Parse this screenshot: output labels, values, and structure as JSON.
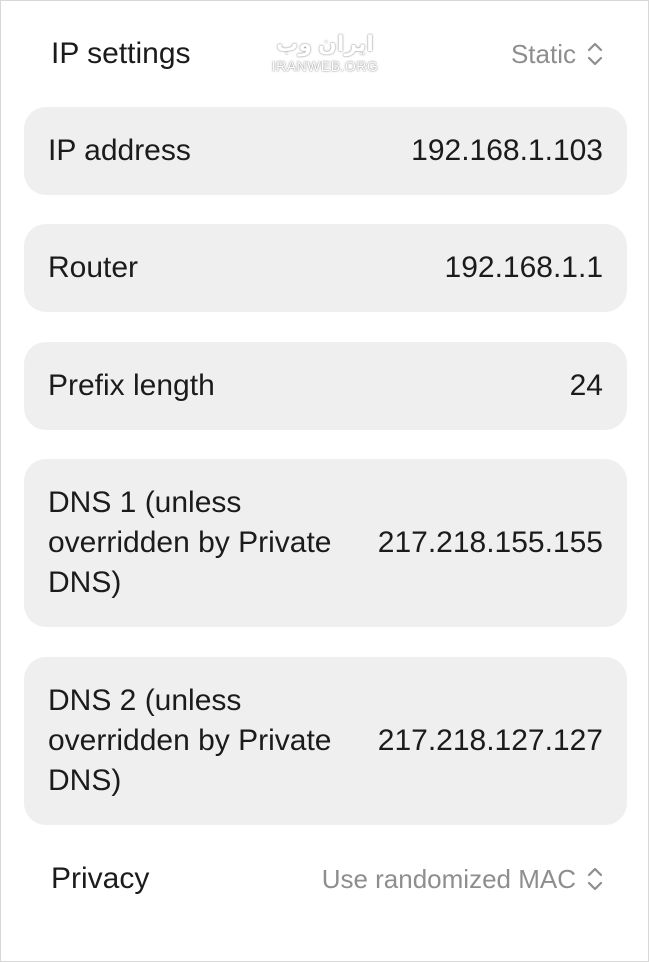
{
  "ip_settings": {
    "label": "IP settings",
    "value": "Static",
    "icon": "up-down-chevron-icon"
  },
  "fields": [
    {
      "label": "IP address",
      "value": "192.168.1.103"
    },
    {
      "label": "Router",
      "value": "192.168.1.1"
    },
    {
      "label": "Prefix length",
      "value": "24"
    },
    {
      "label": "DNS 1 (unless overridden by Private DNS)",
      "value": "217.218.155.155"
    },
    {
      "label": "DNS 2 (unless overridden by Private DNS)",
      "value": "217.218.127.127"
    }
  ],
  "privacy": {
    "label": "Privacy",
    "value": "Use randomized MAC",
    "icon": "up-down-chevron-icon"
  },
  "watermark": {
    "persian": "ایران وب",
    "latin": "IRANWEB.ORG"
  }
}
